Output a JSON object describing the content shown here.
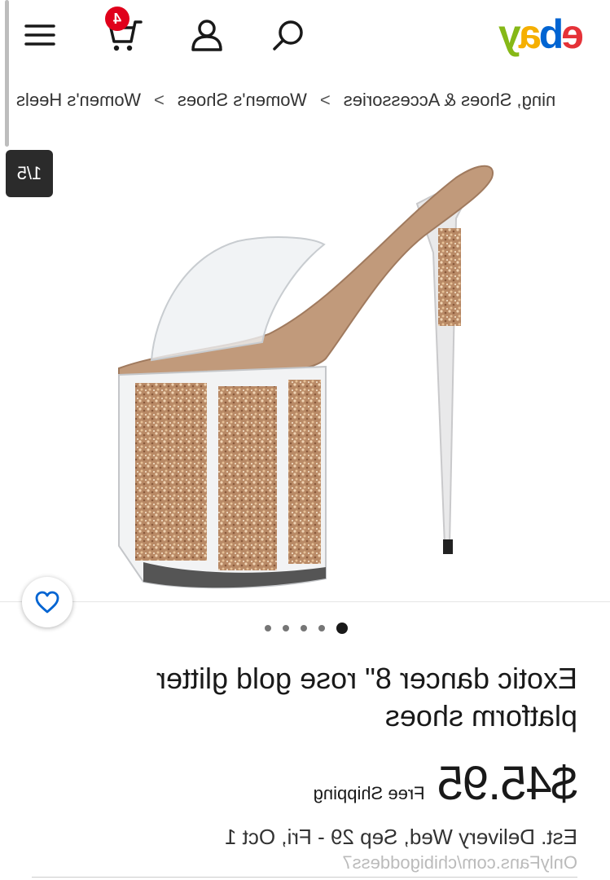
{
  "header": {
    "logo_letters": [
      "e",
      "b",
      "a",
      "y"
    ],
    "cart_count": "4",
    "icons": [
      "hamburger-menu-icon",
      "cart-icon",
      "account-icon",
      "search-icon"
    ]
  },
  "breadcrumb": {
    "items": [
      "ning, Shoes & Accessories",
      "Women's Shoes",
      "Women's Heels"
    ],
    "separator": ">"
  },
  "gallery": {
    "counter": "1/5",
    "dots_total": 5,
    "active_dot": 1
  },
  "item": {
    "title": "Exotic dancer 8\" rose gold glitter platform shoes",
    "price": "$45.95",
    "shipping": "Free Shipping",
    "delivery": "Est. Delivery Wed, Sep 29 - Fri, Oct 1"
  },
  "watermark": "OnlyFans.com/chibigoddess7",
  "colors": {
    "ebay_red": "#e53238",
    "ebay_blue": "#0064d2",
    "ebay_yellow": "#f5af02",
    "ebay_green": "#86b817",
    "badge": "#e0001b",
    "text": "#191919"
  }
}
